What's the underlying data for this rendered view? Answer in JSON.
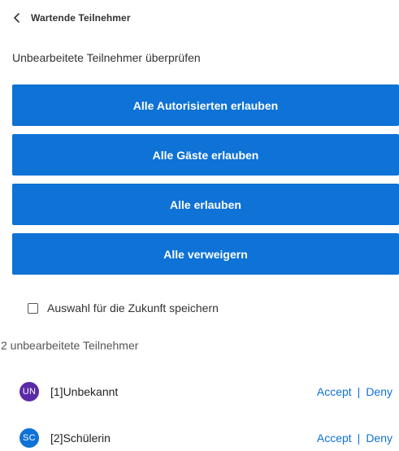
{
  "header": {
    "title": "Wartende Teilnehmer",
    "back_icon": "chevron-left-icon"
  },
  "review": {
    "subtitle": "Unbearbeitete Teilnehmer überprüfen"
  },
  "buttons": {
    "allow_authorized": "Alle Autorisierten erlauben",
    "allow_guests": "Alle Gäste erlauben",
    "allow_all": "Alle erlauben",
    "deny_all": "Alle verweigern"
  },
  "remember": {
    "label": "Auswahl für die Zukunft speichern",
    "checked": false
  },
  "participants": {
    "count_text": "2 unbearbeitete Teilnehmer",
    "items": [
      {
        "initials": "UN",
        "name": "[1]Unbekannt",
        "avatar_color": "#5b2aa8",
        "accept": "Accept",
        "separator": "|",
        "deny": "Deny"
      },
      {
        "initials": "SC",
        "name": "[2]Schülerin",
        "avatar_color": "#0e72d6",
        "accept": "Accept",
        "separator": "|",
        "deny": "Deny"
      }
    ]
  },
  "colors": {
    "accent": "#0e72d6",
    "button_text": "#ffffff"
  }
}
